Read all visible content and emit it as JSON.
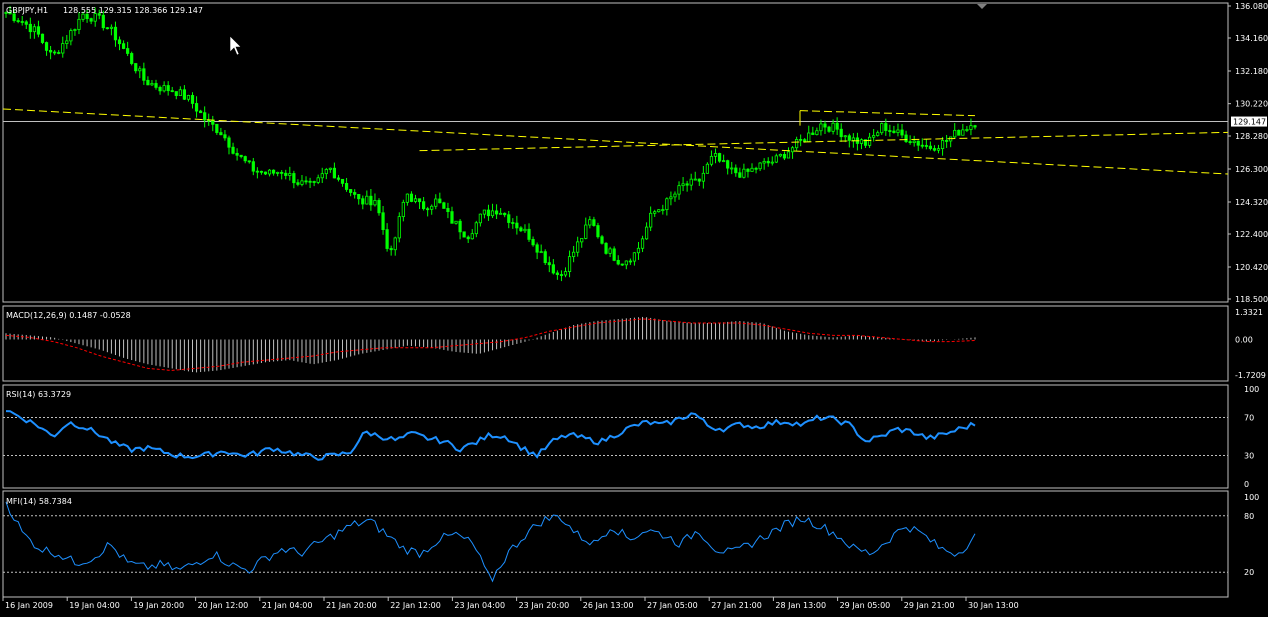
{
  "chart_data": {
    "type": "candlestick-with-indicators",
    "symbol_label": "GBPJPY,H1",
    "ohlc_label": "128.555 129.315 128.366 129.147",
    "current_price": 129.147,
    "current_price_label": "129.147",
    "colors": {
      "candle": "#00ff00",
      "trendline": "#ffff00",
      "price_line": "#c0c0c0",
      "macd_hist": "#c0c0c0",
      "macd_signal": "#ff0000",
      "rsi": "#1e90ff",
      "mfi": "#1e90ff",
      "frame": "#c0c0c0"
    },
    "price_axis": {
      "ylim": [
        118.5,
        136.08
      ],
      "ticks": [
        "136.080",
        "134.160",
        "132.180",
        "130.220",
        "128.280",
        "126.300",
        "124.320",
        "122.400",
        "120.420",
        "118.500"
      ]
    },
    "x_ticks": [
      "16 Jan 2009",
      "19 Jan 04:00",
      "19 Jan 20:00",
      "20 Jan 12:00",
      "21 Jan 04:00",
      "21 Jan 20:00",
      "22 Jan 12:00",
      "23 Jan 04:00",
      "23 Jan 20:00",
      "26 Jan 13:00",
      "27 Jan 05:00",
      "27 Jan 21:00",
      "28 Jan 13:00",
      "29 Jan 05:00",
      "29 Jan 21:00",
      "30 Jan 13:00"
    ],
    "price_anchors": [
      135.7,
      135.2,
      134.5,
      133.0,
      134.2,
      135.6,
      135.3,
      134.4,
      133.0,
      131.6,
      131.2,
      131.0,
      130.4,
      129.2,
      128.5,
      127.2,
      126.3,
      126.0,
      126.2,
      125.5,
      125.2,
      126.4,
      125.4,
      124.3,
      124.5,
      121.0,
      124.9,
      124.0,
      124.4,
      123.2,
      122.3,
      123.6,
      123.9,
      123.1,
      122.3,
      121.0,
      119.8,
      121.5,
      123.2,
      121.5,
      120.7,
      121.3,
      123.6,
      124.3,
      125.3,
      125.5,
      127.1,
      126.2,
      126.0,
      126.5,
      126.8,
      127.5,
      128.2,
      129.0,
      128.7,
      128.1,
      127.8,
      128.9,
      128.4,
      128.0,
      127.6,
      127.9,
      128.6,
      129.1
    ],
    "trendlines": [
      {
        "from_x": 0,
        "from_y": 129.9,
        "to_x": 1,
        "to_y": 126.0
      },
      {
        "from_x": 0.34,
        "from_y": 127.4,
        "to_x": 1,
        "to_y": 128.5
      }
    ],
    "macd": {
      "label": "MACD(12,26,9) 0.1487 -0.0528",
      "ylim": [
        -1.7209,
        1.3321
      ],
      "ticks": [
        "1.3321",
        "0.00",
        "-1.7209"
      ],
      "hist_anchors": [
        0.3,
        0.2,
        0.1,
        -0.2,
        -0.5,
        -0.9,
        -1.2,
        -1.4,
        -1.6,
        -1.5,
        -1.3,
        -1.1,
        -1.0,
        -1.2,
        -1.0,
        -0.7,
        -0.5,
        -0.3,
        -0.4,
        -0.6,
        -0.7,
        -0.4,
        -0.1,
        0.3,
        0.7,
        0.9,
        1.0,
        1.1,
        0.9,
        0.8,
        0.8,
        0.9,
        0.8,
        0.4,
        0.2,
        0.1,
        0.2,
        0.1,
        0.0,
        -0.1,
        0.0,
        0.1
      ],
      "signal_anchors": [
        0.2,
        0.1,
        -0.1,
        -0.4,
        -0.8,
        -1.1,
        -1.4,
        -1.5,
        -1.4,
        -1.3,
        -1.1,
        -1.0,
        -0.9,
        -0.8,
        -0.6,
        -0.5,
        -0.4,
        -0.4,
        -0.4,
        -0.3,
        -0.2,
        -0.1,
        0.1,
        0.4,
        0.6,
        0.8,
        0.9,
        1.0,
        0.9,
        0.8,
        0.8,
        0.8,
        0.7,
        0.5,
        0.3,
        0.2,
        0.2,
        0.1,
        0.0,
        -0.1,
        -0.1,
        -0.05
      ]
    },
    "rsi": {
      "label": "RSI(14) 63.3729",
      "ylim": [
        0,
        100
      ],
      "ticks": [
        100,
        70,
        30,
        0
      ],
      "levels": [
        70,
        30
      ],
      "anchors": [
        78,
        70,
        62,
        50,
        65,
        60,
        52,
        42,
        36,
        38,
        34,
        30,
        29,
        31,
        35,
        30,
        32,
        38,
        34,
        30,
        28,
        30,
        33,
        55,
        50,
        46,
        53,
        48,
        45,
        37,
        43,
        52,
        50,
        38,
        30,
        45,
        52,
        48,
        44,
        52,
        60,
        65,
        62,
        68,
        75,
        60,
        58,
        63,
        60,
        64,
        66,
        62,
        70,
        68,
        62,
        45,
        50,
        58,
        55,
        48,
        52,
        58,
        63
      ]
    },
    "mfi": {
      "label": "MFI(14) 58.7384",
      "ylim": [
        0,
        100
      ],
      "ticks": [
        100,
        80,
        20
      ],
      "levels": [
        80,
        20
      ],
      "anchors": [
        95,
        60,
        45,
        40,
        30,
        35,
        50,
        30,
        25,
        28,
        22,
        30,
        40,
        28,
        22,
        35,
        45,
        40,
        50,
        60,
        70,
        75,
        60,
        45,
        40,
        55,
        60,
        50,
        10,
        40,
        60,
        75,
        80,
        60,
        50,
        70,
        55,
        65,
        60,
        50,
        65,
        45,
        40,
        50,
        60,
        70,
        78,
        70,
        60,
        45,
        40,
        55,
        70,
        60,
        45,
        40,
        58
      ]
    }
  }
}
